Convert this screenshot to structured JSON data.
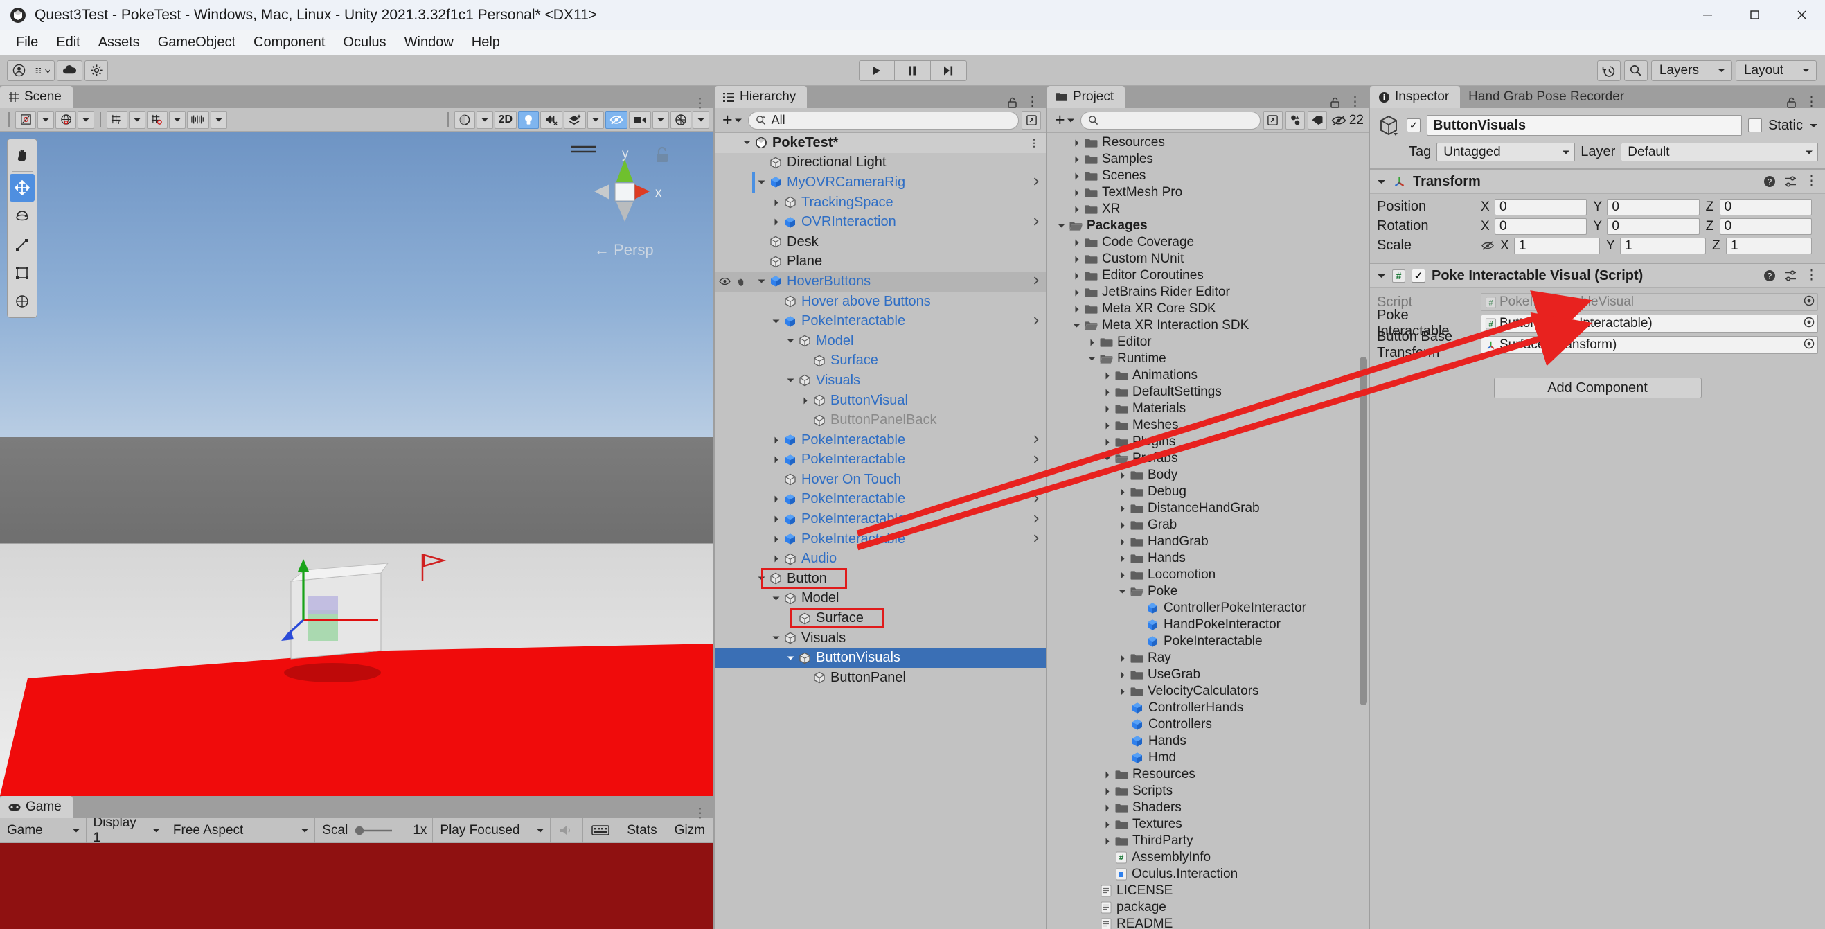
{
  "window": {
    "title": "Quest3Test - PokeTest - Windows, Mac, Linux - Unity 2021.3.32f1c1 Personal* <DX11>",
    "minimize": "─",
    "maximize": "☐",
    "close": "✕"
  },
  "menu": [
    "File",
    "Edit",
    "Assets",
    "GameObject",
    "Component",
    "Oculus",
    "Window",
    "Help"
  ],
  "toolbar": {
    "account_icon": "account-icon",
    "cloud_icon": "cloud-icon",
    "settings_icon": "gear-icon",
    "play": "▶",
    "pause": "▐▐",
    "step": "▶|",
    "history_icon": "undo-history-icon",
    "search_icon": "search-icon",
    "layers": "Layers",
    "layout": "Layout"
  },
  "scene": {
    "tab": "Scene",
    "tab_icon": "grid-icon",
    "toolbar": {
      "pivot": "pivot-icon",
      "global": "globe-icon",
      "grid_snap": "grid-snap-icon",
      "snap_increment": "snap-increment-icon",
      "grid_size": "grid-size-icon",
      "shading": "shading-sphere-icon",
      "mode2d": "2D",
      "lighting": "lightbulb-icon",
      "audio": "audio-mute-icon",
      "fx": "effects-icon",
      "visibility": "scene-visibility-icon",
      "camera": "camera-icon",
      "gizmos": "gizmos-icon"
    },
    "tools": [
      "hand-tool",
      "move-tool",
      "rotate-tool",
      "scale-tool",
      "rect-tool",
      "transform-tool"
    ],
    "selected_tool": "move-tool",
    "gizmo": {
      "x_label": "x",
      "y_label": "y",
      "persp_label": "Persp"
    }
  },
  "game": {
    "tab": "Game",
    "tab_icon": "gamepad-icon",
    "display_mode": "Game",
    "display": "Display 1",
    "aspect": "Free Aspect",
    "scale_label": "Scal",
    "scale_value": "1x",
    "play_mode": "Play Focused",
    "mute_icon": "speaker-icon",
    "keyboard_icon": "keyboard-icon",
    "stats": "Stats",
    "gizmos": "Gizm"
  },
  "hierarchy": {
    "tab": "Hierarchy",
    "tab_icon": "hierarchy-icon",
    "search_value": "All",
    "search_icon": "search-icon",
    "plus": "+",
    "rows": [
      {
        "label": "PokeTest*",
        "indent": 0,
        "arrow": "down",
        "icon": "scene-icon",
        "style": "scene-root",
        "chevron": false,
        "kebab": true
      },
      {
        "label": "Directional Light",
        "indent": 1,
        "arrow": "none",
        "icon": "cube-gray",
        "style": "plain",
        "chevron": false
      },
      {
        "label": "MyOVRCameraRig",
        "indent": 1,
        "arrow": "down",
        "icon": "cube-blue",
        "style": "prefab",
        "chevron": true
      },
      {
        "label": "TrackingSpace",
        "indent": 2,
        "arrow": "right",
        "icon": "cube-gray",
        "style": "prefab",
        "chevron": false
      },
      {
        "label": "OVRInteraction",
        "indent": 2,
        "arrow": "right",
        "icon": "cube-blue",
        "style": "prefab",
        "chevron": true
      },
      {
        "label": "Desk",
        "indent": 1,
        "arrow": "none",
        "icon": "cube-gray",
        "style": "plain",
        "chevron": false
      },
      {
        "label": "Plane",
        "indent": 1,
        "arrow": "none",
        "icon": "cube-gray",
        "style": "plain",
        "chevron": false
      },
      {
        "label": "HoverButtons",
        "indent": 1,
        "arrow": "down",
        "icon": "cube-blue",
        "style": "prefab",
        "chevron": true,
        "hovered": true,
        "vis": true
      },
      {
        "label": "Hover above Buttons",
        "indent": 2,
        "arrow": "none",
        "icon": "cube-gray",
        "style": "prefab",
        "chevron": false
      },
      {
        "label": "PokeInteractable",
        "indent": 2,
        "arrow": "down",
        "icon": "cube-blue",
        "style": "prefab",
        "chevron": true
      },
      {
        "label": "Model",
        "indent": 3,
        "arrow": "down",
        "icon": "cube-gray",
        "style": "prefab",
        "chevron": false
      },
      {
        "label": "Surface",
        "indent": 4,
        "arrow": "none",
        "icon": "cube-gray",
        "style": "prefab",
        "chevron": false
      },
      {
        "label": "Visuals",
        "indent": 3,
        "arrow": "down",
        "icon": "cube-gray",
        "style": "prefab",
        "chevron": false
      },
      {
        "label": "ButtonVisual",
        "indent": 4,
        "arrow": "right",
        "icon": "cube-gray",
        "style": "prefab",
        "chevron": false
      },
      {
        "label": "ButtonPanelBack",
        "indent": 4,
        "arrow": "none",
        "icon": "cube-gray",
        "style": "dim",
        "chevron": false
      },
      {
        "label": "PokeInteractable",
        "indent": 2,
        "arrow": "right",
        "icon": "cube-blue",
        "style": "prefab",
        "chevron": true
      },
      {
        "label": "PokeInteractable",
        "indent": 2,
        "arrow": "right",
        "icon": "cube-blue",
        "style": "prefab",
        "chevron": true
      },
      {
        "label": "Hover On Touch",
        "indent": 2,
        "arrow": "none",
        "icon": "cube-gray",
        "style": "prefab",
        "chevron": false
      },
      {
        "label": "PokeInteractable",
        "indent": 2,
        "arrow": "right",
        "icon": "cube-blue",
        "style": "prefab",
        "chevron": true
      },
      {
        "label": "PokeInteractable",
        "indent": 2,
        "arrow": "right",
        "icon": "cube-blue",
        "style": "prefab",
        "chevron": true
      },
      {
        "label": "PokeInteractable",
        "indent": 2,
        "arrow": "right",
        "icon": "cube-blue",
        "style": "prefab",
        "chevron": true
      },
      {
        "label": "Audio",
        "indent": 2,
        "arrow": "right",
        "icon": "cube-gray",
        "style": "prefab",
        "chevron": false
      },
      {
        "label": "Button",
        "indent": 1,
        "arrow": "down",
        "icon": "cube-gray",
        "style": "plain",
        "chevron": false,
        "highlight_box": true
      },
      {
        "label": "Model",
        "indent": 2,
        "arrow": "down",
        "icon": "cube-gray",
        "style": "plain",
        "chevron": false
      },
      {
        "label": "Surface",
        "indent": 3,
        "arrow": "none",
        "icon": "cube-gray",
        "style": "plain",
        "chevron": false,
        "highlight_box": true
      },
      {
        "label": "Visuals",
        "indent": 2,
        "arrow": "down",
        "icon": "cube-gray",
        "style": "plain",
        "chevron": false
      },
      {
        "label": "ButtonVisuals",
        "indent": 3,
        "arrow": "down",
        "icon": "cube-gray",
        "style": "selected",
        "chevron": false
      },
      {
        "label": "ButtonPanel",
        "indent": 4,
        "arrow": "none",
        "icon": "cube-gray",
        "style": "plain",
        "chevron": false
      }
    ]
  },
  "project": {
    "tab": "Project",
    "tab_icon": "folder-icon",
    "search_value": "",
    "badge_count": "22",
    "badge_icon": "eye-off-icon",
    "tag_icon": "tag-icon",
    "filter_icon": "filter-icon",
    "rows": [
      {
        "label": "Resources",
        "indent": 1,
        "arrow": "right",
        "icon": "folder"
      },
      {
        "label": "Samples",
        "indent": 1,
        "arrow": "right",
        "icon": "folder"
      },
      {
        "label": "Scenes",
        "indent": 1,
        "arrow": "right",
        "icon": "folder"
      },
      {
        "label": "TextMesh Pro",
        "indent": 1,
        "arrow": "right",
        "icon": "folder"
      },
      {
        "label": "XR",
        "indent": 1,
        "arrow": "right",
        "icon": "folder"
      },
      {
        "label": "Packages",
        "indent": 0,
        "arrow": "down",
        "icon": "folder-open",
        "bold": true
      },
      {
        "label": "Code Coverage",
        "indent": 1,
        "arrow": "right",
        "icon": "folder"
      },
      {
        "label": "Custom NUnit",
        "indent": 1,
        "arrow": "right",
        "icon": "folder"
      },
      {
        "label": "Editor Coroutines",
        "indent": 1,
        "arrow": "right",
        "icon": "folder"
      },
      {
        "label": "JetBrains Rider Editor",
        "indent": 1,
        "arrow": "right",
        "icon": "folder"
      },
      {
        "label": "Meta XR Core SDK",
        "indent": 1,
        "arrow": "right",
        "icon": "folder"
      },
      {
        "label": "Meta XR Interaction SDK",
        "indent": 1,
        "arrow": "down",
        "icon": "folder-open"
      },
      {
        "label": "Editor",
        "indent": 2,
        "arrow": "right",
        "icon": "folder"
      },
      {
        "label": "Runtime",
        "indent": 2,
        "arrow": "down",
        "icon": "folder-open"
      },
      {
        "label": "Animations",
        "indent": 3,
        "arrow": "right",
        "icon": "folder"
      },
      {
        "label": "DefaultSettings",
        "indent": 3,
        "arrow": "right",
        "icon": "folder"
      },
      {
        "label": "Materials",
        "indent": 3,
        "arrow": "right",
        "icon": "folder"
      },
      {
        "label": "Meshes",
        "indent": 3,
        "arrow": "right",
        "icon": "folder"
      },
      {
        "label": "Plugins",
        "indent": 3,
        "arrow": "right",
        "icon": "folder"
      },
      {
        "label": "Prefabs",
        "indent": 3,
        "arrow": "down",
        "icon": "folder-open"
      },
      {
        "label": "Body",
        "indent": 4,
        "arrow": "right",
        "icon": "folder"
      },
      {
        "label": "Debug",
        "indent": 4,
        "arrow": "right",
        "icon": "folder"
      },
      {
        "label": "DistanceHandGrab",
        "indent": 4,
        "arrow": "right",
        "icon": "folder"
      },
      {
        "label": "Grab",
        "indent": 4,
        "arrow": "right",
        "icon": "folder"
      },
      {
        "label": "HandGrab",
        "indent": 4,
        "arrow": "right",
        "icon": "folder"
      },
      {
        "label": "Hands",
        "indent": 4,
        "arrow": "right",
        "icon": "folder"
      },
      {
        "label": "Locomotion",
        "indent": 4,
        "arrow": "right",
        "icon": "folder"
      },
      {
        "label": "Poke",
        "indent": 4,
        "arrow": "down",
        "icon": "folder-open"
      },
      {
        "label": "ControllerPokeInteractor",
        "indent": 5,
        "arrow": "none",
        "icon": "prefab"
      },
      {
        "label": "HandPokeInteractor",
        "indent": 5,
        "arrow": "none",
        "icon": "prefab"
      },
      {
        "label": "PokeInteractable",
        "indent": 5,
        "arrow": "none",
        "icon": "prefab"
      },
      {
        "label": "Ray",
        "indent": 4,
        "arrow": "right",
        "icon": "folder"
      },
      {
        "label": "UseGrab",
        "indent": 4,
        "arrow": "right",
        "icon": "folder"
      },
      {
        "label": "VelocityCalculators",
        "indent": 4,
        "arrow": "right",
        "icon": "folder"
      },
      {
        "label": "ControllerHands",
        "indent": 4,
        "arrow": "none",
        "icon": "prefab"
      },
      {
        "label": "Controllers",
        "indent": 4,
        "arrow": "none",
        "icon": "prefab"
      },
      {
        "label": "Hands",
        "indent": 4,
        "arrow": "none",
        "icon": "prefab"
      },
      {
        "label": "Hmd",
        "indent": 4,
        "arrow": "none",
        "icon": "prefab"
      },
      {
        "label": "Resources",
        "indent": 3,
        "arrow": "right",
        "icon": "folder"
      },
      {
        "label": "Scripts",
        "indent": 3,
        "arrow": "right",
        "icon": "folder"
      },
      {
        "label": "Shaders",
        "indent": 3,
        "arrow": "right",
        "icon": "folder"
      },
      {
        "label": "Textures",
        "indent": 3,
        "arrow": "right",
        "icon": "folder"
      },
      {
        "label": "ThirdParty",
        "indent": 3,
        "arrow": "right",
        "icon": "folder"
      },
      {
        "label": "AssemblyInfo",
        "indent": 3,
        "arrow": "none",
        "icon": "script"
      },
      {
        "label": "Oculus.Interaction",
        "indent": 3,
        "arrow": "none",
        "icon": "asmdef"
      },
      {
        "label": "LICENSE",
        "indent": 2,
        "arrow": "none",
        "icon": "text"
      },
      {
        "label": "package",
        "indent": 2,
        "arrow": "none",
        "icon": "text"
      },
      {
        "label": "README",
        "indent": 2,
        "arrow": "none",
        "icon": "text"
      }
    ]
  },
  "inspector": {
    "tab": "Inspector",
    "tab_icon": "info-icon",
    "tab2": "Hand Grab Pose Recorder",
    "object_name": "ButtonVisuals",
    "enabled": true,
    "static_label": "Static",
    "tag_label": "Tag",
    "tag_value": "Untagged",
    "layer_label": "Layer",
    "layer_value": "Default",
    "transform": {
      "title": "Transform",
      "icon": "transform-axis-icon",
      "rows": [
        {
          "label": "Position",
          "x": "0",
          "y": "0",
          "z": "0"
        },
        {
          "label": "Rotation",
          "x": "0",
          "y": "0",
          "z": "0"
        },
        {
          "label": "Scale",
          "x": "1",
          "y": "1",
          "z": "1",
          "constrain_icon": "constrain-off-icon"
        }
      ],
      "axes": [
        "X",
        "Y",
        "Z"
      ]
    },
    "component": {
      "title": "Poke Interactable Visual (Script)",
      "icon": "script-icon",
      "enabled": true,
      "fields": [
        {
          "label": "Script",
          "value": "PokeInteractableVisual",
          "icon": "script-icon",
          "disabled": true
        },
        {
          "label": "Poke Interactable",
          "value": "Button (Poke Interactable)",
          "icon": "script-icon",
          "disabled": false
        },
        {
          "label": "Button Base Transform",
          "value": "Surface (Transform)",
          "icon": "transform-axis-icon",
          "disabled": false
        }
      ]
    },
    "add_component": "Add Component",
    "help_icon": "help-icon",
    "preset_icon": "preset-icon",
    "menu_icon": "kebab-icon"
  },
  "annotations": {
    "arrow_color": "#e8221f",
    "box_color": "#e01b1b"
  }
}
